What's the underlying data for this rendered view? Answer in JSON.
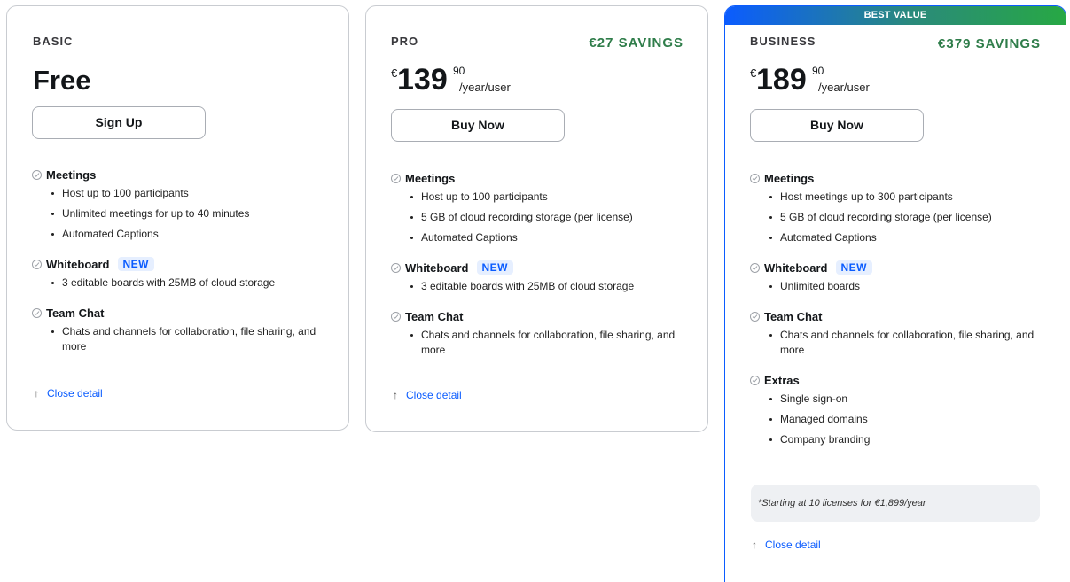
{
  "plans": {
    "basic": {
      "name": "BASIC",
      "price_text": "Free",
      "cta": "Sign Up",
      "features": [
        {
          "title": "Meetings",
          "new": false,
          "items": [
            "Host up to 100 participants",
            "Unlimited meetings for up to 40 minutes",
            "Automated Captions"
          ]
        },
        {
          "title": "Whiteboard",
          "new": true,
          "items": [
            "3 editable boards with 25MB of cloud storage"
          ]
        },
        {
          "title": "Team Chat",
          "new": false,
          "items": [
            "Chats and channels for collaboration, file sharing, and more"
          ]
        }
      ],
      "close_label": "Close detail"
    },
    "pro": {
      "name": "PRO",
      "savings": "€27 SAVINGS",
      "currency": "€",
      "price": "139",
      "price_decimal": "90",
      "price_unit": "/year/user",
      "cta": "Buy Now",
      "features": [
        {
          "title": "Meetings",
          "new": false,
          "items": [
            "Host up to 100 participants",
            "5 GB of cloud recording storage (per license)",
            "Automated Captions"
          ]
        },
        {
          "title": "Whiteboard",
          "new": true,
          "items": [
            "3 editable boards with 25MB of cloud storage"
          ]
        },
        {
          "title": "Team Chat",
          "new": false,
          "items": [
            "Chats and channels for collaboration, file sharing, and more"
          ]
        }
      ],
      "close_label": "Close detail"
    },
    "business": {
      "banner": "BEST VALUE",
      "name": "BUSINESS",
      "savings": "€379 SAVINGS",
      "currency": "€",
      "price": "189",
      "price_decimal": "90",
      "price_unit": "/year/user",
      "cta": "Buy Now",
      "features": [
        {
          "title": "Meetings",
          "new": false,
          "items": [
            "Host meetings up to 300 participants",
            "5 GB of cloud recording storage (per license)",
            "Automated Captions"
          ]
        },
        {
          "title": "Whiteboard",
          "new": true,
          "items": [
            "Unlimited boards"
          ]
        },
        {
          "title": "Team Chat",
          "new": false,
          "items": [
            "Chats and channels for collaboration, file sharing, and more"
          ]
        },
        {
          "title": "Extras",
          "new": false,
          "items": [
            "Single sign-on",
            "Managed domains",
            "Company branding"
          ]
        }
      ],
      "note": "*Starting at 10 licenses for €1,899/year",
      "close_label": "Close detail"
    }
  },
  "new_badge_label": "NEW",
  "colors": {
    "accent_blue": "#0b5cff",
    "savings_green": "#2f7d4a",
    "banner_gradient_end": "#27a844"
  },
  "icons": {
    "feature_bullet": "check-circle-icon",
    "close": "arrow-up-icon"
  }
}
